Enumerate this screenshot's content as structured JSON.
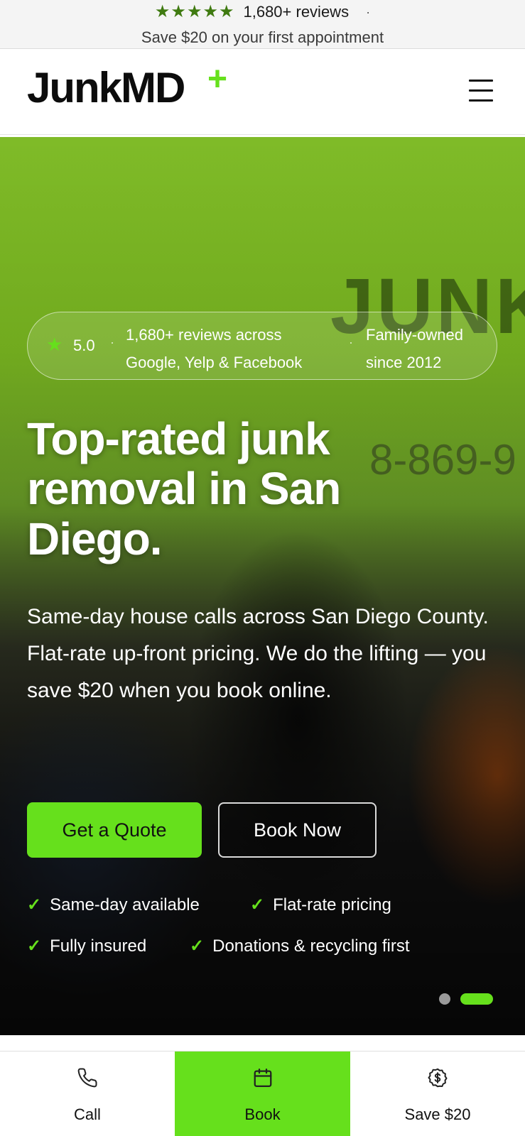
{
  "promo": {
    "stars": "★★★★★",
    "reviews": "1,680+ reviews",
    "dot": "·",
    "offer": "Save $20 on your first appointment"
  },
  "header": {
    "logo": "JunkMD",
    "logo_plus": "+",
    "menu_icon": "hamburger-menu-icon"
  },
  "hero": {
    "background_truck_text": "JUNKM",
    "background_phone": "8-869-9",
    "trust": {
      "star": "★",
      "score": "5.0",
      "dot": "·",
      "reviews": "1,680+ reviews across Google, Yelp & Facebook",
      "family": "Family-owned since 2012"
    },
    "headline": "Top-rated junk removal in San Diego.",
    "subtext": "Same-day house calls across San Diego County. Flat-rate up-front pricing. We do the lifting — you save $20 when you book online.",
    "cta_primary": "Get a Quote",
    "cta_secondary": "Book Now",
    "features": [
      {
        "check": "✓",
        "label": "Same-day available"
      },
      {
        "check": "✓",
        "label": "Flat-rate pricing"
      },
      {
        "check": "✓",
        "label": "Fully insured"
      },
      {
        "check": "✓",
        "label": "Donations & recycling first"
      }
    ],
    "carousel": {
      "count": 2,
      "active": 2
    }
  },
  "bottom_nav": {
    "items": [
      {
        "label": "Call",
        "icon": "phone-icon"
      },
      {
        "label": "Book",
        "icon": "calendar-icon",
        "active": true
      },
      {
        "label": "Save $20",
        "icon": "dollar-badge-icon"
      }
    ]
  },
  "colors": {
    "accent": "#66e01c",
    "star_green": "#3f7a10",
    "text_dark": "#111111"
  }
}
